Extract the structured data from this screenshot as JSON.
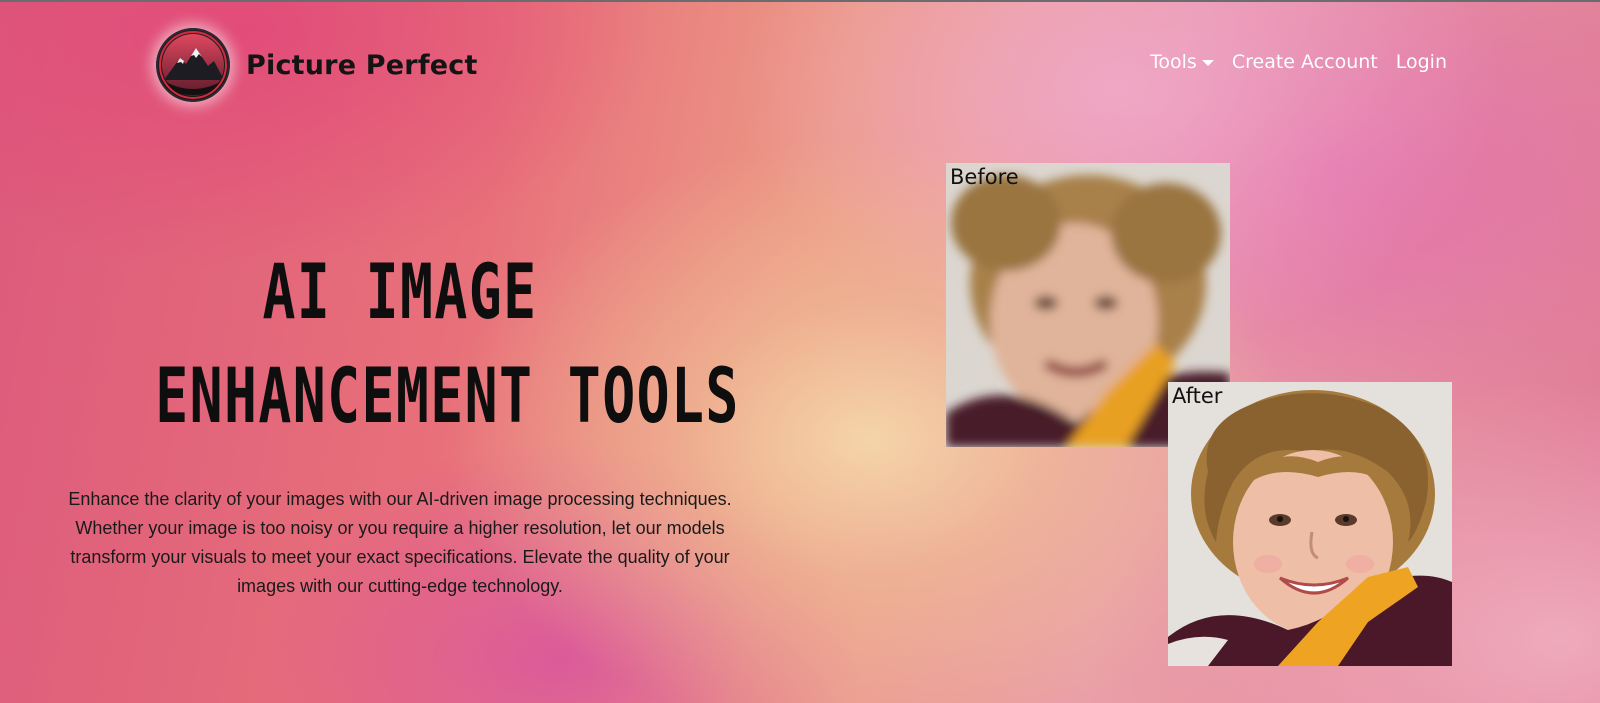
{
  "brand": {
    "name": "Picture Perfect",
    "logo_icon": "mountain-logo-icon"
  },
  "nav": {
    "tools_label": "Tools",
    "create_account_label": "Create Account",
    "login_label": "Login"
  },
  "hero": {
    "title_line1": "AI IMAGE",
    "title_line2": "ENHANCEMENT TOOLS",
    "description": "Enhance the clarity of your images with our AI-driven image processing techniques. Whether your image is too noisy or you require a higher resolution, let our models transform your visuals to meet your exact specifications. Elevate the quality of your images with our cutting-edge technology."
  },
  "comparison": {
    "before_label": "Before",
    "after_label": "After"
  },
  "colors": {
    "brand_text": "#141414",
    "nav_text": "#ffffff",
    "logo_red": "#d42a3c"
  }
}
